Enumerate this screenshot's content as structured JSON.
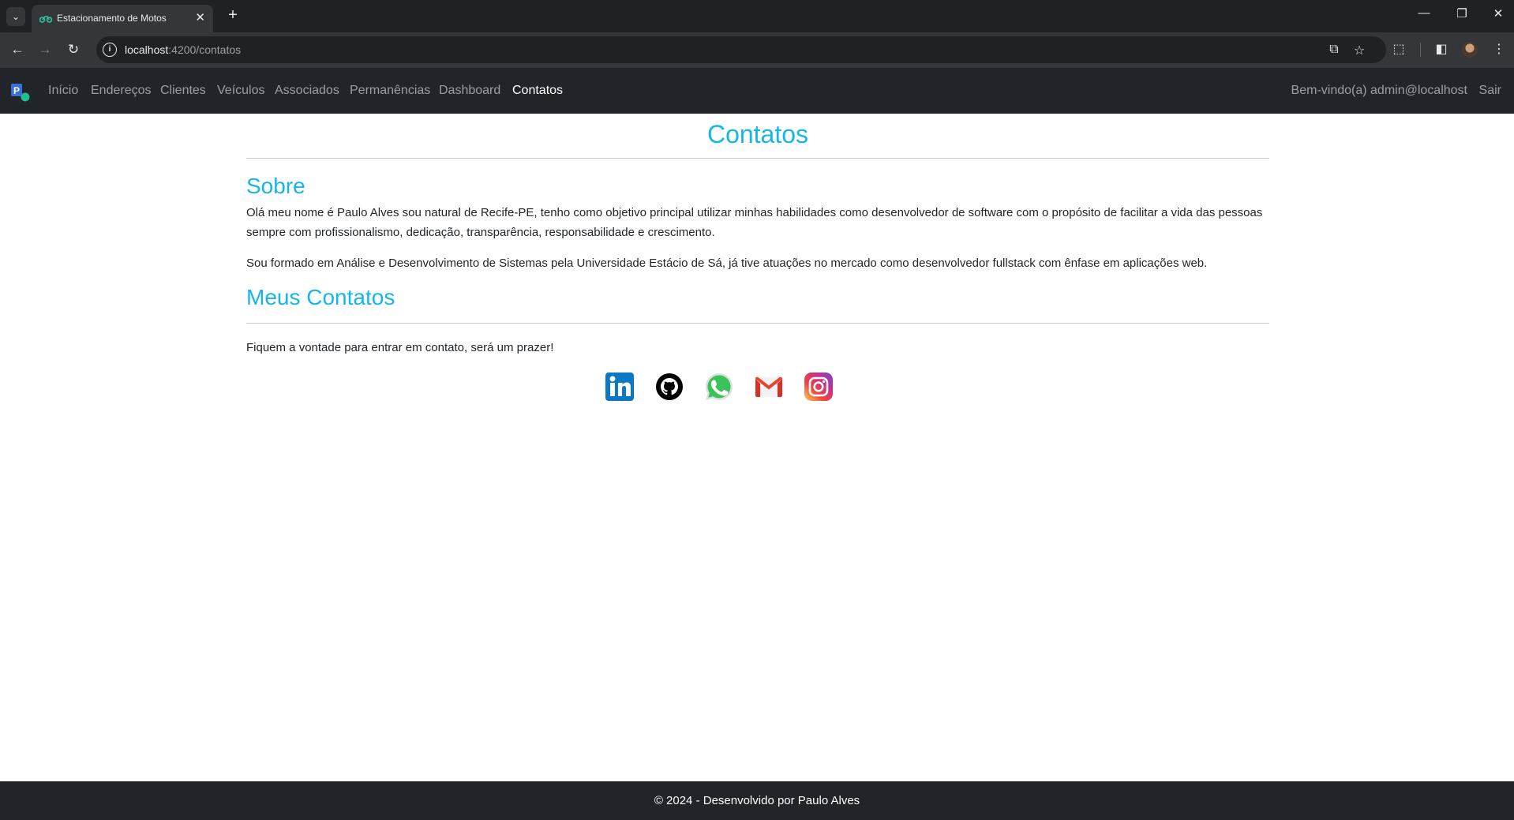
{
  "browser": {
    "tab_title": "Estacionamento de Motos",
    "url_host": "localhost",
    "url_path": ":4200/contatos",
    "new_tab_symbol": "+",
    "close_symbol": "✕"
  },
  "navbar": {
    "items": [
      {
        "label": "Início",
        "active": false
      },
      {
        "label": "Endereços",
        "active": false
      },
      {
        "label": "Clientes",
        "active": false
      },
      {
        "label": "Veículos",
        "active": false
      },
      {
        "label": "Associados",
        "active": false
      },
      {
        "label": "Permanências",
        "active": false
      },
      {
        "label": "Dashboard",
        "active": false
      },
      {
        "label": "Contatos",
        "active": true
      }
    ],
    "welcome": "Bem-vindo(a) admin@localhost",
    "logout": "Sair"
  },
  "content": {
    "title": "Contatos",
    "about_title": "Sobre",
    "about_p1": "Olá meu nome é Paulo Alves sou natural de Recife-PE, tenho como objetivo principal utilizar minhas habilidades como desenvolvedor de software com o propósito de facilitar a vida das pessoas sempre com profissionalismo, dedicação, transparência, responsabilidade e crescimento.",
    "about_p2": "Sou formado em Análise e Desenvolvimento de Sistemas pela Universidade Estácio de Sá, já tive atuações no mercado como desenvolvedor fullstack com ênfase em aplicações web.",
    "contacts_title": "Meus Contatos",
    "contacts_text": "Fiquem a vontade para entrar em contato, será um prazer!",
    "socials": [
      "linkedin-icon",
      "github-icon",
      "whatsapp-icon",
      "gmail-icon",
      "instagram-icon"
    ]
  },
  "footer": {
    "text": "© 2024 - Desenvolvido por Paulo Alves"
  },
  "colors": {
    "accent": "#17b6e8",
    "navbar_bg": "#212529"
  }
}
